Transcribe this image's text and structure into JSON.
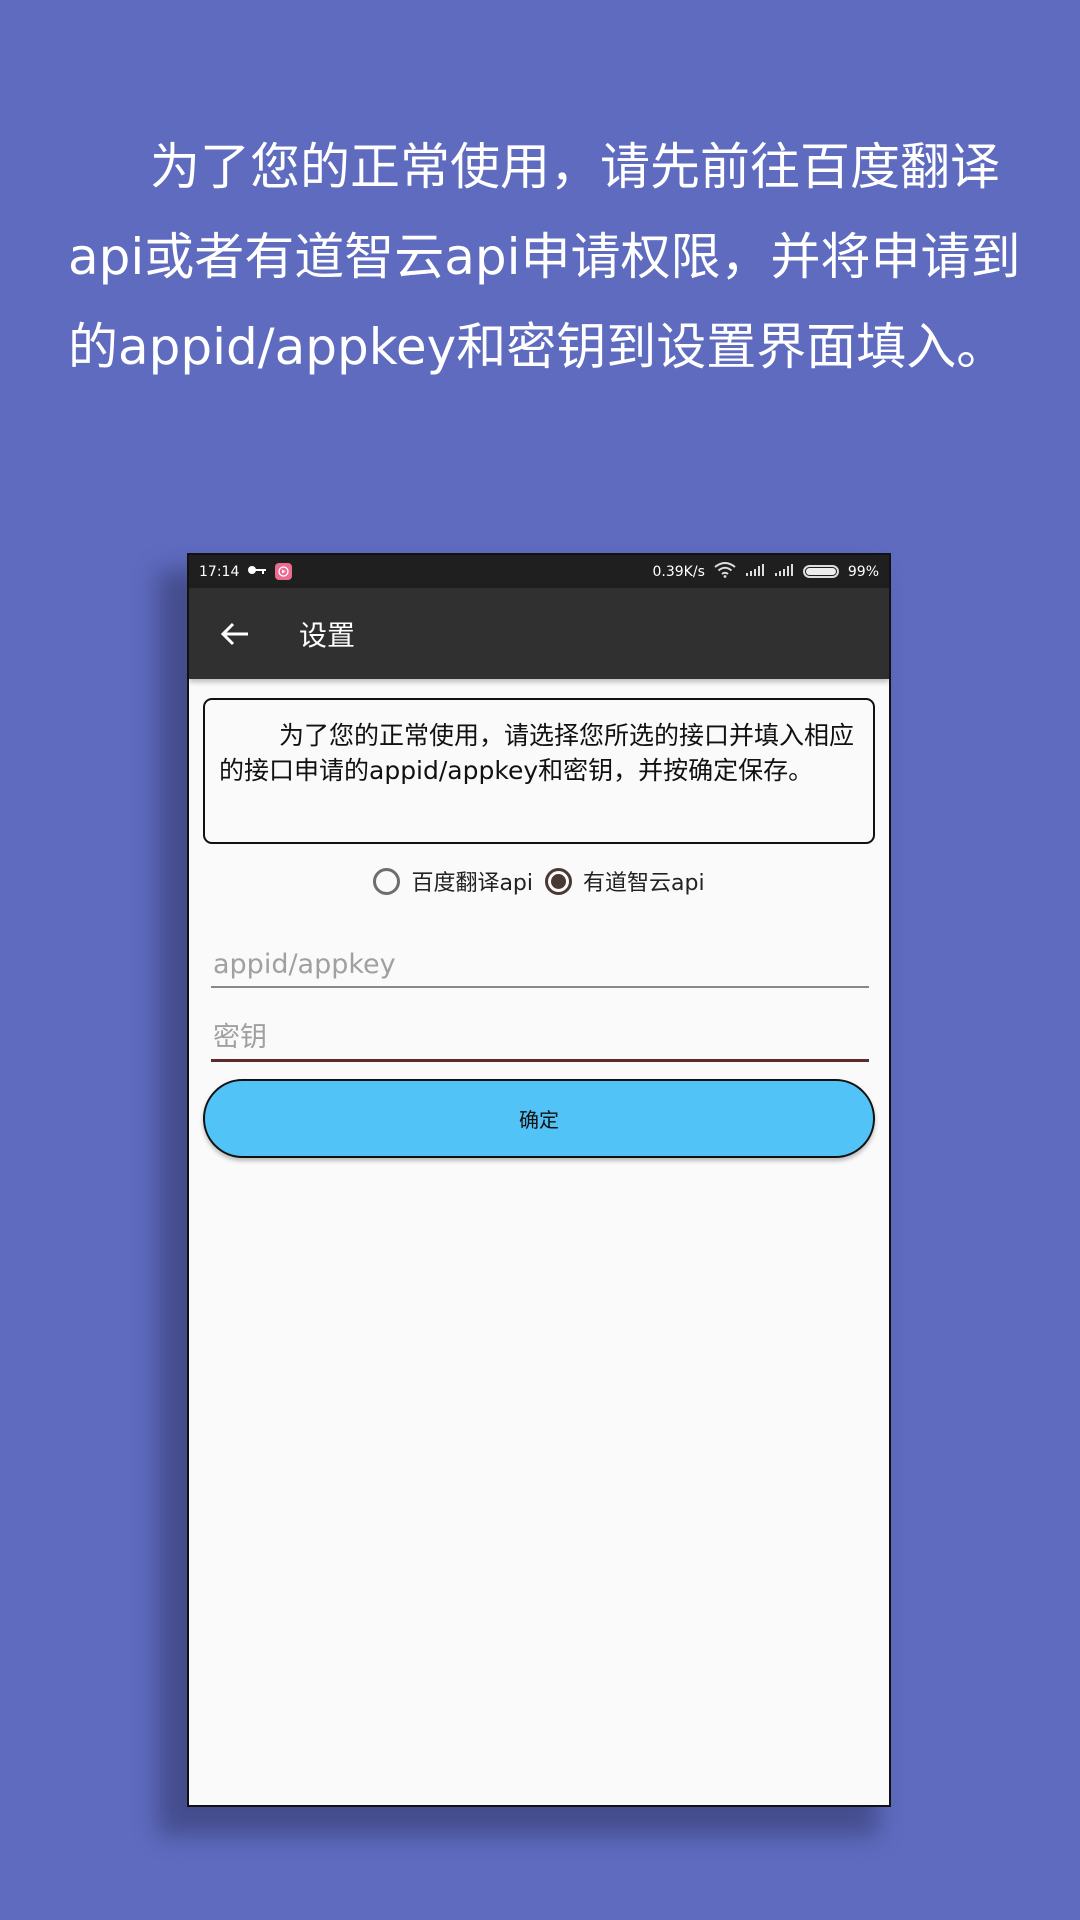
{
  "promo": {
    "text": "为了您的正常使用，请先前往百度翻译api或者有道智云api申请权限，并将申请到的appid/appkey和密钥到设置界面填入。"
  },
  "status_bar": {
    "time": "17:14",
    "net_speed": "0.39K/s",
    "battery": "99%",
    "battery_level": 0.99
  },
  "app_bar": {
    "title": "设置",
    "back_icon": "arrow-left-icon"
  },
  "notice": {
    "text": "为了您的正常使用，请选择您所选的接口并填入相应的接口申请的appid/appkey和密钥，并按确定保存。"
  },
  "api_selector": {
    "options": [
      {
        "label": "百度翻译api",
        "checked": false
      },
      {
        "label": "有道智云api",
        "checked": true
      }
    ]
  },
  "form": {
    "appid_placeholder": "appid/appkey",
    "appid_value": "",
    "secret_placeholder": "密钥",
    "secret_value": "",
    "confirm_label": "确定"
  },
  "colors": {
    "background": "#5e6bbf",
    "app_bar": "#303030",
    "status_bar": "#1f1f1f",
    "button": "#52c3f6",
    "radio_checked": "#4a3834"
  }
}
